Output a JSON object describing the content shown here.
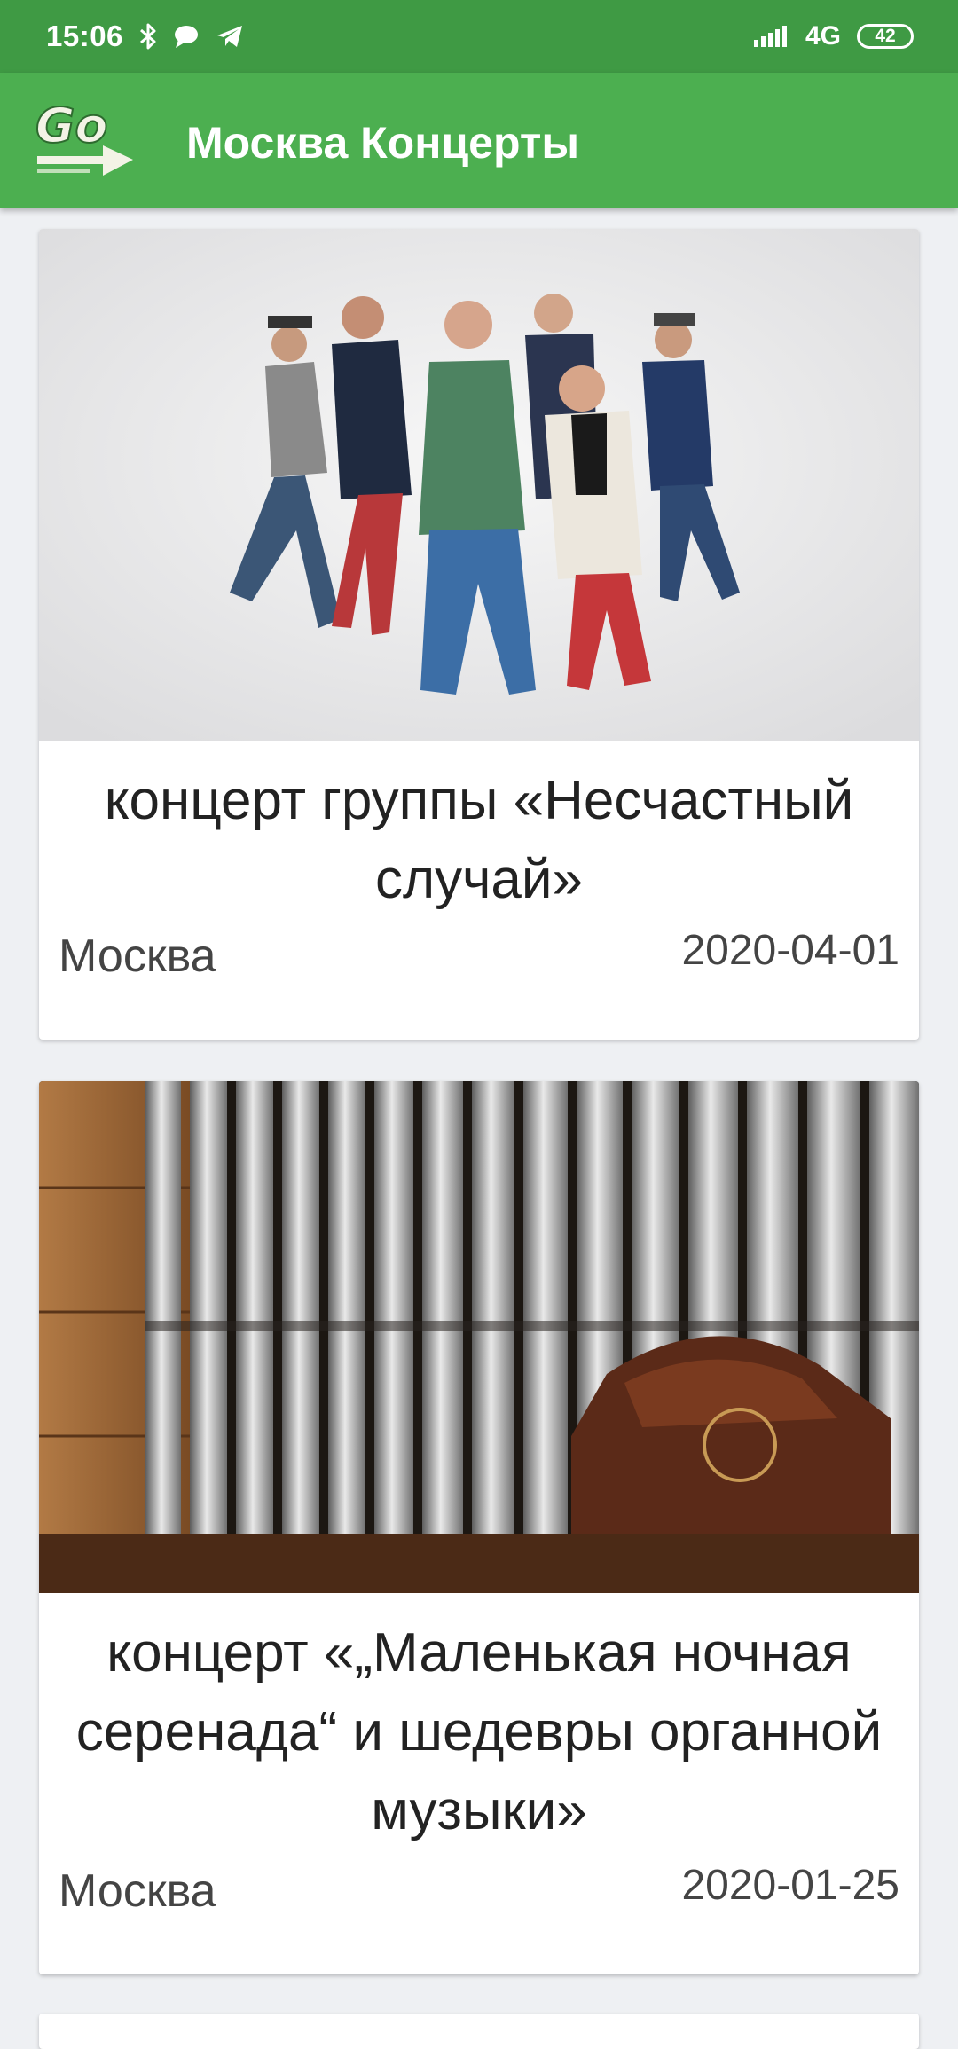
{
  "status_bar": {
    "time": "15:06",
    "network": "4G",
    "battery": "42",
    "icons": [
      "bluetooth-icon",
      "message-icon",
      "telegram-icon",
      "signal-icon"
    ]
  },
  "app_bar": {
    "logo_text": "Go",
    "title": "Москва Концерты",
    "color": "#4caf50"
  },
  "events": [
    {
      "title": "концерт группы «Несчастный случай»",
      "city": "Москва",
      "date": "2020-04-01",
      "image": "band-photo"
    },
    {
      "title": "концерт «„Маленькая ночная серенада“ и шедевры органной музыки»",
      "city": "Москва",
      "date": "2020-01-25",
      "image": "organ-pipes-photo"
    }
  ]
}
